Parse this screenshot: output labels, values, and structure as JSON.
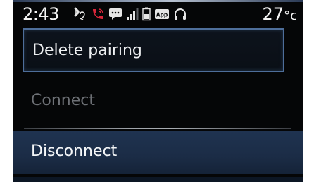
{
  "status_bar": {
    "time": "2:43",
    "temperature": "27",
    "temperature_unit": "°c",
    "icons": [
      "bluetooth-phone-icon",
      "phone-call-icon",
      "message-icon",
      "signal-icon",
      "battery-icon",
      "app-icon",
      "headphones-icon"
    ],
    "app_icon_text": "App",
    "accent_color": "#d8263a"
  },
  "menu": {
    "items": [
      {
        "label": "Delete pairing",
        "state": "focused"
      },
      {
        "label": "Connect",
        "state": "disabled"
      },
      {
        "label": "Disconnect",
        "state": "selected"
      }
    ]
  },
  "colors": {
    "background": "#050607",
    "focus_border": "#4e6e9a",
    "selected_bg": "#1f3350",
    "disabled_text": "#6d7075"
  }
}
